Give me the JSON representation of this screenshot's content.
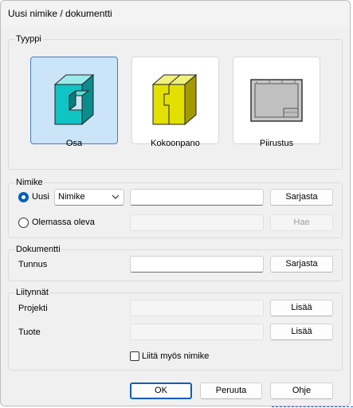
{
  "window": {
    "title": "Uusi nimike / dokumentti"
  },
  "tyyppi": {
    "legend": "Tyyppi",
    "cards": [
      {
        "label": "Osa",
        "selected": true,
        "icon": "part-icon"
      },
      {
        "label": "Kokoonpano",
        "selected": false,
        "icon": "assembly-icon"
      },
      {
        "label": "Piirustus",
        "selected": false,
        "icon": "drawing-icon"
      }
    ]
  },
  "nimike": {
    "legend": "Nimike",
    "uusi_label": "Uusi",
    "uusi_checked": true,
    "type_select": "Nimike",
    "name_value": "",
    "sarjasta_label": "Sarjasta",
    "olemassa_label": "Olemassa oleva",
    "olemassa_checked": false,
    "existing_value": "",
    "hae_label": "Hae"
  },
  "dokumentti": {
    "legend": "Dokumentti",
    "tunnus_label": "Tunnus",
    "tunnus_value": "",
    "sarjasta_label": "Sarjasta"
  },
  "liitynnat": {
    "legend": "Liitynnät",
    "projekti_label": "Projekti",
    "projekti_value": "",
    "projekti_button": "Lisää",
    "tuote_label": "Tuote",
    "tuote_value": "",
    "tuote_button": "Lisää",
    "liita_label": "Liitä myös nimike",
    "liita_checked": false
  },
  "footer": {
    "ok": "OK",
    "peruuta": "Peruuta",
    "ohje": "Ohje"
  },
  "colors": {
    "accent": "#005fb8",
    "part_cyan": "#10c4c4",
    "assembly_yellow": "#e2e000",
    "selected_card": "#cce4f7"
  }
}
